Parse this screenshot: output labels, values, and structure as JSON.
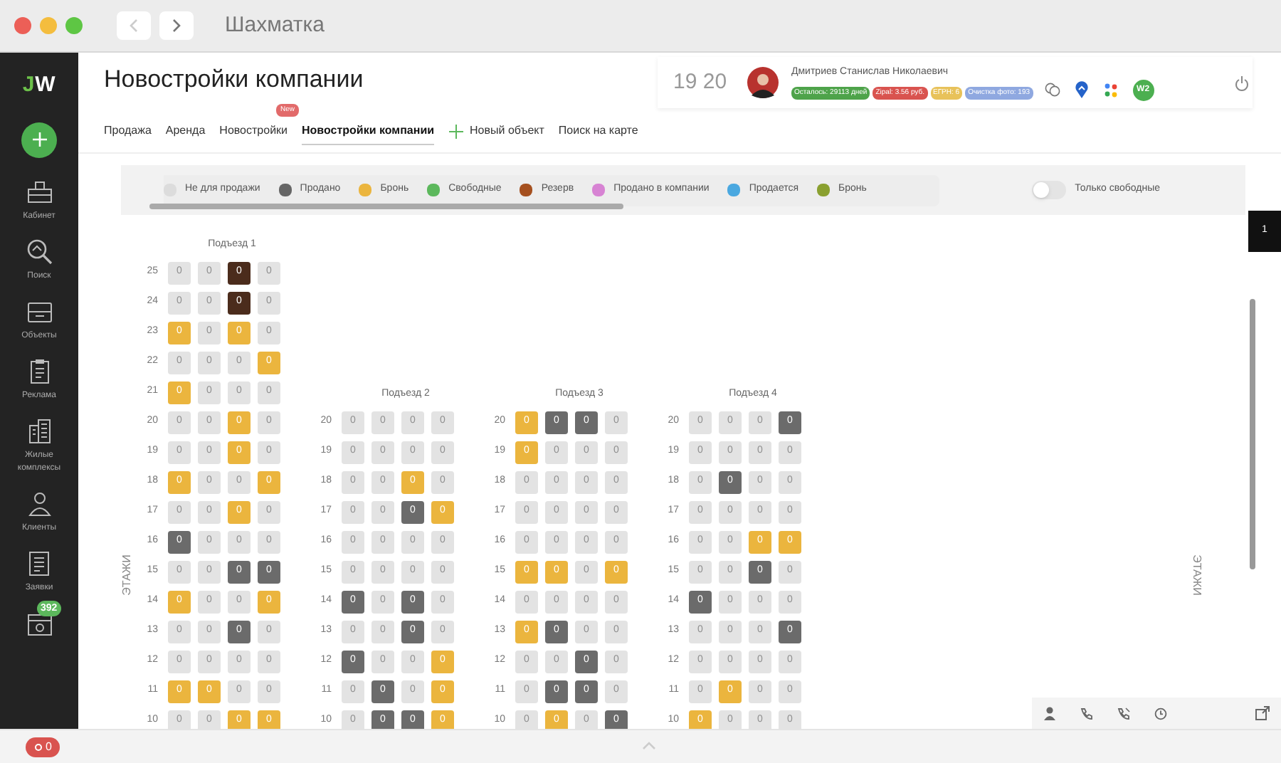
{
  "window": {
    "title": "Шахматка"
  },
  "sidebar": {
    "logo_first": "J",
    "logo_rest": "W",
    "items": [
      {
        "label": "Кабинет"
      },
      {
        "label": "Поиск"
      },
      {
        "label": "Объекты"
      },
      {
        "label": "Реклама"
      },
      {
        "label": "Жилые комплексы"
      },
      {
        "label": "Клиенты"
      },
      {
        "label": "Заявки"
      },
      {
        "badge": "392"
      }
    ]
  },
  "page_title": "Новостройки компании",
  "tabs": [
    {
      "label": "Продажа",
      "selected": false
    },
    {
      "label": "Аренда",
      "selected": false
    },
    {
      "label": "Новостройки",
      "selected": false,
      "badge": "New"
    },
    {
      "label": "Новостройки компании",
      "selected": true
    },
    {
      "label": "Новый объект",
      "selected": false,
      "kind": "add"
    },
    {
      "label": "Поиск на карте",
      "selected": false
    }
  ],
  "user_panel": {
    "time": "19 20",
    "name": "Дмитриев Станислав Николаевич",
    "badges": [
      {
        "text": "Осталось: 29113 дней",
        "color": "#4ea34a"
      },
      {
        "text": "Zipal: 3.56 руб.",
        "color": "#d9534f"
      },
      {
        "text": "ЕГРН: 6",
        "color": "#e8c25a"
      },
      {
        "text": "Очистка фото: 193",
        "color": "#8fa8e0"
      }
    ],
    "user_initials": "W2"
  },
  "legend": [
    {
      "label": "Не для продажи",
      "color": "#dcdcdc"
    },
    {
      "label": "Продано",
      "color": "#666666"
    },
    {
      "label": "Бронь",
      "color": "#ebb53e"
    },
    {
      "label": "Свободные",
      "color": "#5cb85c"
    },
    {
      "label": "Резерв",
      "color": "#a5501f"
    },
    {
      "label": "Продано в компании",
      "color": "#d783d3"
    },
    {
      "label": "Продается",
      "color": "#4aa8e0"
    },
    {
      "label": "Бронь",
      "color": "#8aa030"
    }
  ],
  "only_free": {
    "label": "Только свободные",
    "on": false
  },
  "page_tab": "1",
  "axis_label_left": "ЭТАЖИ",
  "axis_label_right": "ЭТАЖИ",
  "entrances": [
    {
      "title": "Подъезд 1",
      "floors": [
        {
          "floor": "25",
          "cells": [
            {
              "label": "0",
              "kind": "none"
            },
            {
              "label": "0",
              "kind": "none"
            },
            {
              "label": "0",
              "kind": "reserve"
            },
            {
              "label": "0",
              "kind": "none"
            }
          ]
        },
        {
          "floor": "24",
          "cells": [
            {
              "label": "0",
              "kind": "none"
            },
            {
              "label": "0",
              "kind": "none"
            },
            {
              "label": "0",
              "kind": "reserve"
            },
            {
              "label": "0",
              "kind": "none"
            }
          ]
        },
        {
          "floor": "23",
          "cells": [
            {
              "label": "0",
              "kind": "booked"
            },
            {
              "label": "0",
              "kind": "none"
            },
            {
              "label": "0",
              "kind": "booked"
            },
            {
              "label": "0",
              "kind": "none"
            }
          ]
        },
        {
          "floor": "22",
          "cells": [
            {
              "label": "0",
              "kind": "none"
            },
            {
              "label": "0",
              "kind": "none"
            },
            {
              "label": "0",
              "kind": "none"
            },
            {
              "label": "0",
              "kind": "booked"
            }
          ]
        },
        {
          "floor": "21",
          "cells": [
            {
              "label": "0",
              "kind": "booked"
            },
            {
              "label": "0",
              "kind": "none"
            },
            {
              "label": "0",
              "kind": "none"
            },
            {
              "label": "0",
              "kind": "none"
            }
          ]
        },
        {
          "floor": "20",
          "cells": [
            {
              "label": "0",
              "kind": "none"
            },
            {
              "label": "0",
              "kind": "none"
            },
            {
              "label": "0",
              "kind": "booked"
            },
            {
              "label": "0",
              "kind": "none"
            }
          ]
        },
        {
          "floor": "19",
          "cells": [
            {
              "label": "0",
              "kind": "none"
            },
            {
              "label": "0",
              "kind": "none"
            },
            {
              "label": "0",
              "kind": "booked"
            },
            {
              "label": "0",
              "kind": "none"
            }
          ]
        },
        {
          "floor": "18",
          "cells": [
            {
              "label": "0",
              "kind": "booked"
            },
            {
              "label": "0",
              "kind": "none"
            },
            {
              "label": "0",
              "kind": "none"
            },
            {
              "label": "0",
              "kind": "booked"
            }
          ]
        },
        {
          "floor": "17",
          "cells": [
            {
              "label": "0",
              "kind": "none"
            },
            {
              "label": "0",
              "kind": "none"
            },
            {
              "label": "0",
              "kind": "booked"
            },
            {
              "label": "0",
              "kind": "none"
            }
          ]
        },
        {
          "floor": "16",
          "cells": [
            {
              "label": "0",
              "kind": "sold"
            },
            {
              "label": "0",
              "kind": "none"
            },
            {
              "label": "0",
              "kind": "none"
            },
            {
              "label": "0",
              "kind": "none"
            }
          ]
        },
        {
          "floor": "15",
          "cells": [
            {
              "label": "0",
              "kind": "none"
            },
            {
              "label": "0",
              "kind": "none"
            },
            {
              "label": "0",
              "kind": "sold"
            },
            {
              "label": "0",
              "kind": "sold"
            }
          ]
        },
        {
          "floor": "14",
          "cells": [
            {
              "label": "0",
              "kind": "booked"
            },
            {
              "label": "0",
              "kind": "none"
            },
            {
              "label": "0",
              "kind": "none"
            },
            {
              "label": "0",
              "kind": "booked"
            }
          ]
        },
        {
          "floor": "13",
          "cells": [
            {
              "label": "0",
              "kind": "none"
            },
            {
              "label": "0",
              "kind": "none"
            },
            {
              "label": "0",
              "kind": "sold"
            },
            {
              "label": "0",
              "kind": "none"
            }
          ]
        },
        {
          "floor": "12",
          "cells": [
            {
              "label": "0",
              "kind": "none"
            },
            {
              "label": "0",
              "kind": "none"
            },
            {
              "label": "0",
              "kind": "none"
            },
            {
              "label": "0",
              "kind": "none"
            }
          ]
        },
        {
          "floor": "11",
          "cells": [
            {
              "label": "0",
              "kind": "booked"
            },
            {
              "label": "0",
              "kind": "booked"
            },
            {
              "label": "0",
              "kind": "none"
            },
            {
              "label": "0",
              "kind": "none"
            }
          ]
        },
        {
          "floor": "10",
          "cells": [
            {
              "label": "0",
              "kind": "none"
            },
            {
              "label": "0",
              "kind": "none"
            },
            {
              "label": "0",
              "kind": "booked"
            },
            {
              "label": "0",
              "kind": "booked"
            }
          ]
        }
      ]
    },
    {
      "title": "Подъезд 2",
      "floors": [
        {
          "floor": "20",
          "cells": [
            {
              "label": "0",
              "kind": "none"
            },
            {
              "label": "0",
              "kind": "none"
            },
            {
              "label": "0",
              "kind": "none"
            },
            {
              "label": "0",
              "kind": "none"
            }
          ]
        },
        {
          "floor": "19",
          "cells": [
            {
              "label": "0",
              "kind": "none"
            },
            {
              "label": "0",
              "kind": "none"
            },
            {
              "label": "0",
              "kind": "none"
            },
            {
              "label": "0",
              "kind": "none"
            }
          ]
        },
        {
          "floor": "18",
          "cells": [
            {
              "label": "0",
              "kind": "none"
            },
            {
              "label": "0",
              "kind": "none"
            },
            {
              "label": "0",
              "kind": "booked"
            },
            {
              "label": "0",
              "kind": "none"
            }
          ]
        },
        {
          "floor": "17",
          "cells": [
            {
              "label": "0",
              "kind": "none"
            },
            {
              "label": "0",
              "kind": "none"
            },
            {
              "label": "0",
              "kind": "sold"
            },
            {
              "label": "0",
              "kind": "booked"
            }
          ]
        },
        {
          "floor": "16",
          "cells": [
            {
              "label": "0",
              "kind": "none"
            },
            {
              "label": "0",
              "kind": "none"
            },
            {
              "label": "0",
              "kind": "none"
            },
            {
              "label": "0",
              "kind": "none"
            }
          ]
        },
        {
          "floor": "15",
          "cells": [
            {
              "label": "0",
              "kind": "none"
            },
            {
              "label": "0",
              "kind": "none"
            },
            {
              "label": "0",
              "kind": "none"
            },
            {
              "label": "0",
              "kind": "none"
            }
          ]
        },
        {
          "floor": "14",
          "cells": [
            {
              "label": "0",
              "kind": "sold"
            },
            {
              "label": "0",
              "kind": "none"
            },
            {
              "label": "0",
              "kind": "sold"
            },
            {
              "label": "0",
              "kind": "none"
            }
          ]
        },
        {
          "floor": "13",
          "cells": [
            {
              "label": "0",
              "kind": "none"
            },
            {
              "label": "0",
              "kind": "none"
            },
            {
              "label": "0",
              "kind": "sold"
            },
            {
              "label": "0",
              "kind": "none"
            }
          ]
        },
        {
          "floor": "12",
          "cells": [
            {
              "label": "0",
              "kind": "sold"
            },
            {
              "label": "0",
              "kind": "none"
            },
            {
              "label": "0",
              "kind": "none"
            },
            {
              "label": "0",
              "kind": "booked"
            }
          ]
        },
        {
          "floor": "11",
          "cells": [
            {
              "label": "0",
              "kind": "none"
            },
            {
              "label": "0",
              "kind": "sold"
            },
            {
              "label": "0",
              "kind": "none"
            },
            {
              "label": "0",
              "kind": "booked"
            }
          ]
        },
        {
          "floor": "10",
          "cells": [
            {
              "label": "0",
              "kind": "none"
            },
            {
              "label": "0",
              "kind": "sold"
            },
            {
              "label": "0",
              "kind": "sold"
            },
            {
              "label": "0",
              "kind": "booked"
            }
          ]
        }
      ]
    },
    {
      "title": "Подъезд 3",
      "floors": [
        {
          "floor": "20",
          "cells": [
            {
              "label": "0",
              "kind": "booked"
            },
            {
              "label": "0",
              "kind": "sold"
            },
            {
              "label": "0",
              "kind": "sold"
            },
            {
              "label": "0",
              "kind": "none"
            }
          ]
        },
        {
          "floor": "19",
          "cells": [
            {
              "label": "0",
              "kind": "booked"
            },
            {
              "label": "0",
              "kind": "none"
            },
            {
              "label": "0",
              "kind": "none"
            },
            {
              "label": "0",
              "kind": "none"
            }
          ]
        },
        {
          "floor": "18",
          "cells": [
            {
              "label": "0",
              "kind": "none"
            },
            {
              "label": "0",
              "kind": "none"
            },
            {
              "label": "0",
              "kind": "none"
            },
            {
              "label": "0",
              "kind": "none"
            }
          ]
        },
        {
          "floor": "17",
          "cells": [
            {
              "label": "0",
              "kind": "none"
            },
            {
              "label": "0",
              "kind": "none"
            },
            {
              "label": "0",
              "kind": "none"
            },
            {
              "label": "0",
              "kind": "none"
            }
          ]
        },
        {
          "floor": "16",
          "cells": [
            {
              "label": "0",
              "kind": "none"
            },
            {
              "label": "0",
              "kind": "none"
            },
            {
              "label": "0",
              "kind": "none"
            },
            {
              "label": "0",
              "kind": "none"
            }
          ]
        },
        {
          "floor": "15",
          "cells": [
            {
              "label": "0",
              "kind": "booked"
            },
            {
              "label": "0",
              "kind": "booked"
            },
            {
              "label": "0",
              "kind": "none"
            },
            {
              "label": "0",
              "kind": "booked"
            }
          ]
        },
        {
          "floor": "14",
          "cells": [
            {
              "label": "0",
              "kind": "none"
            },
            {
              "label": "0",
              "kind": "none"
            },
            {
              "label": "0",
              "kind": "none"
            },
            {
              "label": "0",
              "kind": "none"
            }
          ]
        },
        {
          "floor": "13",
          "cells": [
            {
              "label": "0",
              "kind": "booked"
            },
            {
              "label": "0",
              "kind": "sold"
            },
            {
              "label": "0",
              "kind": "none"
            },
            {
              "label": "0",
              "kind": "none"
            }
          ]
        },
        {
          "floor": "12",
          "cells": [
            {
              "label": "0",
              "kind": "none"
            },
            {
              "label": "0",
              "kind": "none"
            },
            {
              "label": "0",
              "kind": "sold"
            },
            {
              "label": "0",
              "kind": "none"
            }
          ]
        },
        {
          "floor": "11",
          "cells": [
            {
              "label": "0",
              "kind": "none"
            },
            {
              "label": "0",
              "kind": "sold"
            },
            {
              "label": "0",
              "kind": "sold"
            },
            {
              "label": "0",
              "kind": "none"
            }
          ]
        },
        {
          "floor": "10",
          "cells": [
            {
              "label": "0",
              "kind": "none"
            },
            {
              "label": "0",
              "kind": "booked"
            },
            {
              "label": "0",
              "kind": "none"
            },
            {
              "label": "0",
              "kind": "sold"
            }
          ]
        }
      ]
    },
    {
      "title": "Подъезд 4",
      "floors": [
        {
          "floor": "20",
          "cells": [
            {
              "label": "0",
              "kind": "none"
            },
            {
              "label": "0",
              "kind": "none"
            },
            {
              "label": "0",
              "kind": "none"
            },
            {
              "label": "0",
              "kind": "sold"
            }
          ]
        },
        {
          "floor": "19",
          "cells": [
            {
              "label": "0",
              "kind": "none"
            },
            {
              "label": "0",
              "kind": "none"
            },
            {
              "label": "0",
              "kind": "none"
            },
            {
              "label": "0",
              "kind": "none"
            }
          ]
        },
        {
          "floor": "18",
          "cells": [
            {
              "label": "0",
              "kind": "none"
            },
            {
              "label": "0",
              "kind": "sold"
            },
            {
              "label": "0",
              "kind": "none"
            },
            {
              "label": "0",
              "kind": "none"
            }
          ]
        },
        {
          "floor": "17",
          "cells": [
            {
              "label": "0",
              "kind": "none"
            },
            {
              "label": "0",
              "kind": "none"
            },
            {
              "label": "0",
              "kind": "none"
            },
            {
              "label": "0",
              "kind": "none"
            }
          ]
        },
        {
          "floor": "16",
          "cells": [
            {
              "label": "0",
              "kind": "none"
            },
            {
              "label": "0",
              "kind": "none"
            },
            {
              "label": "0",
              "kind": "booked"
            },
            {
              "label": "0",
              "kind": "booked"
            }
          ]
        },
        {
          "floor": "15",
          "cells": [
            {
              "label": "0",
              "kind": "none"
            },
            {
              "label": "0",
              "kind": "none"
            },
            {
              "label": "0",
              "kind": "sold"
            },
            {
              "label": "0",
              "kind": "none"
            }
          ]
        },
        {
          "floor": "14",
          "cells": [
            {
              "label": "0",
              "kind": "sold"
            },
            {
              "label": "0",
              "kind": "none"
            },
            {
              "label": "0",
              "kind": "none"
            },
            {
              "label": "0",
              "kind": "none"
            }
          ]
        },
        {
          "floor": "13",
          "cells": [
            {
              "label": "0",
              "kind": "none"
            },
            {
              "label": "0",
              "kind": "none"
            },
            {
              "label": "0",
              "kind": "none"
            },
            {
              "label": "0",
              "kind": "sold"
            }
          ]
        },
        {
          "floor": "12",
          "cells": [
            {
              "label": "0",
              "kind": "none"
            },
            {
              "label": "0",
              "kind": "none"
            },
            {
              "label": "0",
              "kind": "none"
            },
            {
              "label": "0",
              "kind": "none"
            }
          ]
        },
        {
          "floor": "11",
          "cells": [
            {
              "label": "0",
              "kind": "none"
            },
            {
              "label": "0",
              "kind": "booked"
            },
            {
              "label": "0",
              "kind": "none"
            },
            {
              "label": "0",
              "kind": "none"
            }
          ]
        },
        {
          "floor": "10",
          "cells": [
            {
              "label": "0",
              "kind": "booked"
            },
            {
              "label": "0",
              "kind": "none"
            },
            {
              "label": "0",
              "kind": "none"
            },
            {
              "label": "0",
              "kind": "none"
            }
          ]
        }
      ]
    }
  ],
  "status_bar": {
    "counter": "0"
  }
}
